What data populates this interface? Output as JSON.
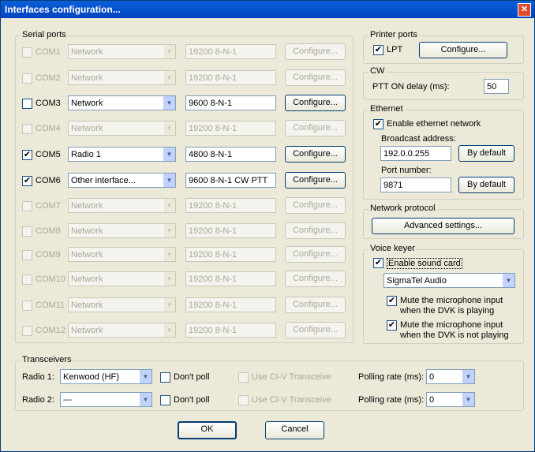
{
  "window": {
    "title": "Interfaces configuration...",
    "close": "✕"
  },
  "serial": {
    "legend": "Serial ports",
    "rows": [
      {
        "port": "COM1",
        "iface": "Network",
        "params": "19200 8-N-1",
        "checked": false,
        "enabled": false
      },
      {
        "port": "COM2",
        "iface": "Network",
        "params": "19200 8-N-1",
        "checked": false,
        "enabled": false
      },
      {
        "port": "COM3",
        "iface": "Network",
        "params": "9600 8-N-1",
        "checked": false,
        "enabled": true
      },
      {
        "port": "COM4",
        "iface": "Network",
        "params": "19200 8-N-1",
        "checked": false,
        "enabled": false
      },
      {
        "port": "COM5",
        "iface": "Radio 1",
        "params": "4800 8-N-1",
        "checked": true,
        "enabled": true
      },
      {
        "port": "COM6",
        "iface": "Other interface...",
        "params": "9600 8-N-1 CW PTT",
        "checked": true,
        "enabled": true
      },
      {
        "port": "COM7",
        "iface": "Network",
        "params": "19200 8-N-1",
        "checked": false,
        "enabled": false
      },
      {
        "port": "COM8",
        "iface": "Network",
        "params": "19200 8-N-1",
        "checked": false,
        "enabled": false
      },
      {
        "port": "COM9",
        "iface": "Network",
        "params": "19200 8-N-1",
        "checked": false,
        "enabled": false
      },
      {
        "port": "COM10",
        "iface": "Network",
        "params": "19200 8-N-1",
        "checked": false,
        "enabled": false
      },
      {
        "port": "COM11",
        "iface": "Network",
        "params": "19200 8-N-1",
        "checked": false,
        "enabled": false
      },
      {
        "port": "COM12",
        "iface": "Network",
        "params": "19200 8-N-1",
        "checked": false,
        "enabled": false
      }
    ],
    "configure_label": "Configure...",
    "check_glyph": "✔",
    "arrow_glyph": "▼"
  },
  "printer": {
    "legend": "Printer ports",
    "lpt_label": "LPT",
    "lpt_checked": true,
    "configure_label": "Configure..."
  },
  "cw": {
    "legend": "CW",
    "ptt_label": "PTT ON delay (ms):",
    "ptt_value": "50"
  },
  "ethernet": {
    "legend": "Ethernet",
    "enable_label": "Enable ethernet network",
    "broadcast_label": "Broadcast address:",
    "broadcast_value": "192.0.0.255",
    "default_label": "By default",
    "port_label": "Port number:",
    "port_value": "9871"
  },
  "netproto": {
    "legend": "Network protocol",
    "advanced_label": "Advanced settings..."
  },
  "voice": {
    "legend": "Voice keyer",
    "enable_label": "Enable sound card",
    "device": "SigmaTel Audio",
    "mute1_line1": "Mute the microphone input",
    "mute1_line2": "when the DVK is playing",
    "mute2_line1": "Mute the microphone input",
    "mute2_line2": "when the DVK is not playing"
  },
  "transceivers": {
    "legend": "Transceivers",
    "rows": [
      {
        "label": "Radio 1:",
        "value": "Kenwood (HF)",
        "dontpoll": "Don't poll",
        "civ": "Use CI-V Transceive",
        "rate_label": "Polling rate (ms):",
        "rate": "0"
      },
      {
        "label": "Radio 2:",
        "value": "---",
        "dontpoll": "Don't poll",
        "civ": "Use CI-V Transceive",
        "rate_label": "Polling rate (ms):",
        "rate": "0"
      }
    ]
  },
  "buttons": {
    "ok": "OK",
    "cancel": "Cancel"
  }
}
